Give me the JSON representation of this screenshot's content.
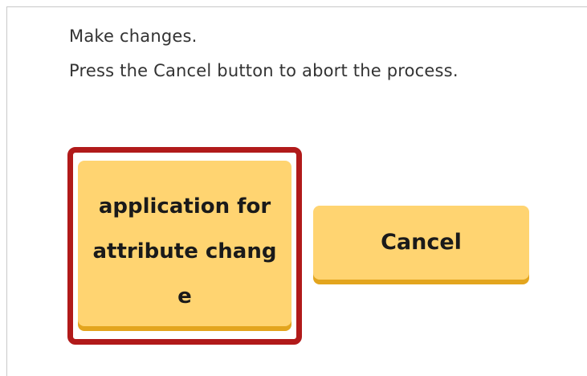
{
  "instructions": {
    "line1": "Make changes.",
    "line2": "Press the Cancel button to abort the process."
  },
  "buttons": {
    "apply_label_line1": "application for",
    "apply_label_line2": "attribute chang",
    "apply_label_line3": "e",
    "cancel_label": "Cancel"
  },
  "colors": {
    "button_fill": "#ffd471",
    "button_shadow": "#e3a51e",
    "highlight_border": "#b11a1a"
  }
}
